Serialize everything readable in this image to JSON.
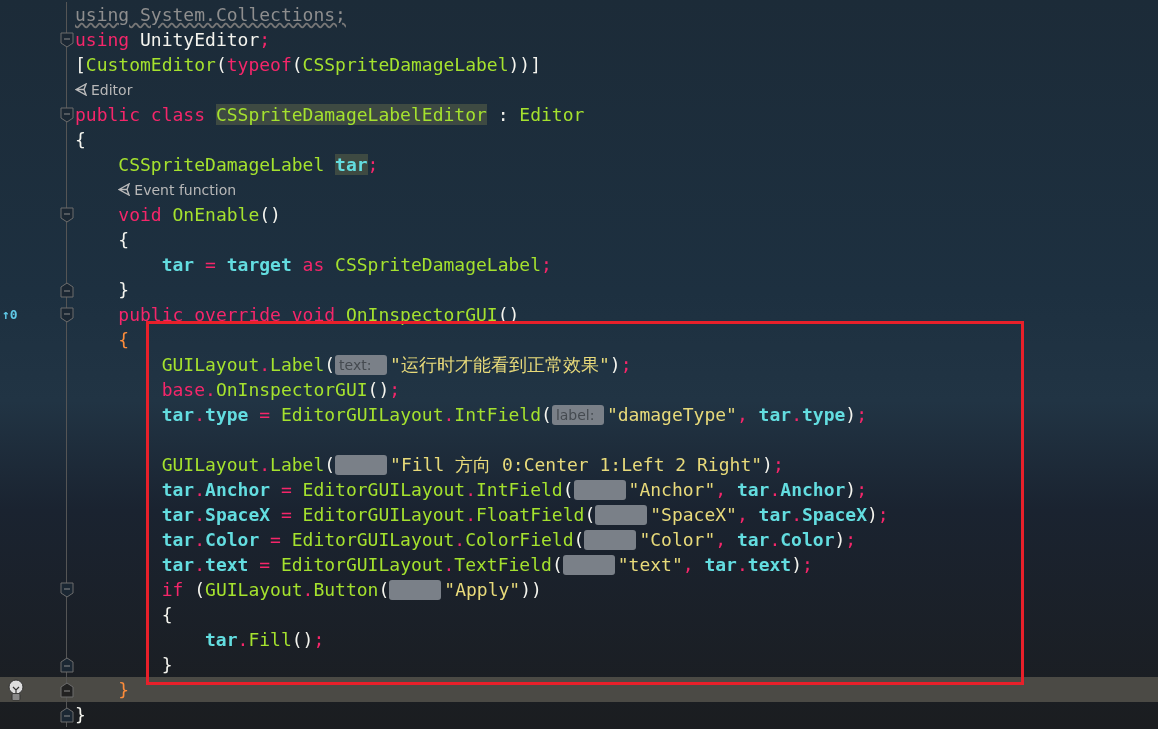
{
  "editor": {
    "lines": [
      {
        "kind": "code",
        "current": false,
        "fold_start": false,
        "fold_end": false,
        "tokens": [
          {
            "kind": "unused",
            "text": "using System.Collections;"
          }
        ]
      },
      {
        "kind": "code",
        "current": false,
        "fold_start": true,
        "fold_end": false,
        "tokens": [
          {
            "kind": "keyword",
            "text": "using"
          },
          {
            "kind": "plain",
            "text": " UnityEditor"
          },
          {
            "kind": "keyword",
            "text": ";"
          }
        ]
      },
      {
        "kind": "code",
        "current": false,
        "fold_start": false,
        "fold_end": false,
        "tokens": [
          {
            "kind": "plain",
            "text": "["
          },
          {
            "kind": "type",
            "text": "CustomEditor"
          },
          {
            "kind": "plain",
            "text": "("
          },
          {
            "kind": "keyword",
            "text": "typeof"
          },
          {
            "kind": "plain",
            "text": "("
          },
          {
            "kind": "type",
            "text": "CSSpriteDamageLabel"
          },
          {
            "kind": "plain",
            "text": "))]"
          }
        ]
      },
      {
        "kind": "codelens",
        "current": false,
        "fold_start": false,
        "fold_end": false,
        "text": "Editor"
      },
      {
        "kind": "code",
        "current": false,
        "fold_start": true,
        "fold_end": false,
        "tokens": [
          {
            "kind": "keyword",
            "text": "public class "
          },
          {
            "kind": "type",
            "text": "CSSpriteDamageLabelEditor",
            "mark": true
          },
          {
            "kind": "plain",
            "text": " : "
          },
          {
            "kind": "type",
            "text": "Editor"
          }
        ]
      },
      {
        "kind": "code",
        "current": false,
        "fold_start": false,
        "fold_end": false,
        "tokens": [
          {
            "kind": "plain",
            "text": "{"
          }
        ],
        "children": [
          {
            "kind": "code",
            "current": false,
            "fold_start": false,
            "fold_end": false,
            "tokens": [
              {
                "kind": "type",
                "text": "CSSpriteDamageLabel "
              },
              {
                "kind": "identifier",
                "text": "tar",
                "mark": true
              },
              {
                "kind": "keyword",
                "text": ";"
              }
            ]
          },
          {
            "kind": "codelens",
            "current": false,
            "fold_start": false,
            "fold_end": false,
            "text": "Event function"
          },
          {
            "kind": "code",
            "current": false,
            "fold_start": true,
            "fold_end": false,
            "tokens": [
              {
                "kind": "keyword",
                "text": "void "
              },
              {
                "kind": "type",
                "text": "OnEnable"
              },
              {
                "kind": "plain",
                "text": "()"
              }
            ]
          },
          {
            "kind": "code",
            "current": false,
            "fold_start": false,
            "fold_end": false,
            "tokens": [
              {
                "kind": "plain",
                "text": "{"
              }
            ],
            "children": [
              {
                "kind": "code",
                "current": false,
                "fold_start": false,
                "fold_end": false,
                "tokens": [
                  {
                    "kind": "identifier",
                    "text": "tar"
                  },
                  {
                    "kind": "keyword",
                    "text": " = "
                  },
                  {
                    "kind": "identifier",
                    "text": "target"
                  },
                  {
                    "kind": "keyword",
                    "text": " as "
                  },
                  {
                    "kind": "type",
                    "text": "CSSpriteDamageLabel"
                  },
                  {
                    "kind": "keyword",
                    "text": ";"
                  }
                ]
              }
            ]
          },
          {
            "kind": "code",
            "current": false,
            "fold_start": false,
            "fold_end": true,
            "tokens": [
              {
                "kind": "plain",
                "text": "}"
              }
            ]
          },
          {
            "kind": "code",
            "current": false,
            "fold_start": true,
            "fold_end": false,
            "badge": "↑0",
            "tokens": [
              {
                "kind": "keyword",
                "text": "public override void "
              },
              {
                "kind": "type",
                "text": "OnInspectorGUI"
              },
              {
                "kind": "plain",
                "text": "()"
              }
            ]
          },
          {
            "kind": "code",
            "current": false,
            "fold_start": false,
            "fold_end": false,
            "tokens": [
              {
                "kind": "brace",
                "text": "{"
              }
            ],
            "children": [
              {
                "kind": "code",
                "current": false,
                "fold_start": false,
                "fold_end": false,
                "tokens": [
                  {
                    "kind": "type",
                    "text": "GUILayout"
                  },
                  {
                    "kind": "keyword",
                    "text": "."
                  },
                  {
                    "kind": "type",
                    "text": "Label"
                  },
                  {
                    "kind": "plain",
                    "text": "("
                  },
                  {
                    "kind": "hint",
                    "text": "text:"
                  },
                  {
                    "kind": "string",
                    "text": "\"运行时才能看到正常效果\""
                  },
                  {
                    "kind": "plain",
                    "text": ")"
                  },
                  {
                    "kind": "keyword",
                    "text": ";"
                  }
                ]
              },
              {
                "kind": "code",
                "current": false,
                "fold_start": false,
                "fold_end": false,
                "tokens": [
                  {
                    "kind": "keyword",
                    "text": "base"
                  },
                  {
                    "kind": "keyword",
                    "text": "."
                  },
                  {
                    "kind": "type",
                    "text": "OnInspectorGUI"
                  },
                  {
                    "kind": "plain",
                    "text": "()"
                  },
                  {
                    "kind": "keyword",
                    "text": ";"
                  }
                ]
              },
              {
                "kind": "code",
                "current": false,
                "fold_start": false,
                "fold_end": false,
                "tokens": [
                  {
                    "kind": "identifier",
                    "text": "tar"
                  },
                  {
                    "kind": "keyword",
                    "text": "."
                  },
                  {
                    "kind": "identifier",
                    "text": "type"
                  },
                  {
                    "kind": "keyword",
                    "text": " = "
                  },
                  {
                    "kind": "type",
                    "text": "EditorGUILayout"
                  },
                  {
                    "kind": "keyword",
                    "text": "."
                  },
                  {
                    "kind": "type",
                    "text": "IntField"
                  },
                  {
                    "kind": "plain",
                    "text": "("
                  },
                  {
                    "kind": "hint",
                    "text": "label:"
                  },
                  {
                    "kind": "string",
                    "text": "\"damageType\""
                  },
                  {
                    "kind": "keyword",
                    "text": ", "
                  },
                  {
                    "kind": "identifier",
                    "text": "tar"
                  },
                  {
                    "kind": "keyword",
                    "text": "."
                  },
                  {
                    "kind": "identifier",
                    "text": "type"
                  },
                  {
                    "kind": "plain",
                    "text": ")"
                  },
                  {
                    "kind": "keyword",
                    "text": ";"
                  }
                ]
              },
              {
                "kind": "blank",
                "current": false,
                "fold_start": false,
                "fold_end": false
              },
              {
                "kind": "code",
                "current": false,
                "fold_start": false,
                "fold_end": false,
                "tokens": [
                  {
                    "kind": "type",
                    "text": "GUILayout"
                  },
                  {
                    "kind": "keyword",
                    "text": "."
                  },
                  {
                    "kind": "type",
                    "text": "Label"
                  },
                  {
                    "kind": "plain",
                    "text": "("
                  },
                  {
                    "kind": "hint"
                  },
                  {
                    "kind": "string",
                    "text": "\"Fill 方向 0:Center 1:Left 2 Right\""
                  },
                  {
                    "kind": "plain",
                    "text": ")"
                  },
                  {
                    "kind": "keyword",
                    "text": ";"
                  }
                ]
              },
              {
                "kind": "code",
                "current": false,
                "fold_start": false,
                "fold_end": false,
                "tokens": [
                  {
                    "kind": "identifier",
                    "text": "tar"
                  },
                  {
                    "kind": "keyword",
                    "text": "."
                  },
                  {
                    "kind": "identifier",
                    "text": "Anchor"
                  },
                  {
                    "kind": "keyword",
                    "text": " = "
                  },
                  {
                    "kind": "type",
                    "text": "EditorGUILayout"
                  },
                  {
                    "kind": "keyword",
                    "text": "."
                  },
                  {
                    "kind": "type",
                    "text": "IntField"
                  },
                  {
                    "kind": "plain",
                    "text": "("
                  },
                  {
                    "kind": "hint"
                  },
                  {
                    "kind": "string",
                    "text": "\"Anchor\""
                  },
                  {
                    "kind": "keyword",
                    "text": ", "
                  },
                  {
                    "kind": "identifier",
                    "text": "tar"
                  },
                  {
                    "kind": "keyword",
                    "text": "."
                  },
                  {
                    "kind": "identifier",
                    "text": "Anchor"
                  },
                  {
                    "kind": "plain",
                    "text": ")"
                  },
                  {
                    "kind": "keyword",
                    "text": ";"
                  }
                ]
              },
              {
                "kind": "code",
                "current": false,
                "fold_start": false,
                "fold_end": false,
                "tokens": [
                  {
                    "kind": "identifier",
                    "text": "tar"
                  },
                  {
                    "kind": "keyword",
                    "text": "."
                  },
                  {
                    "kind": "identifier",
                    "text": "SpaceX"
                  },
                  {
                    "kind": "keyword",
                    "text": " = "
                  },
                  {
                    "kind": "type",
                    "text": "EditorGUILayout"
                  },
                  {
                    "kind": "keyword",
                    "text": "."
                  },
                  {
                    "kind": "type",
                    "text": "FloatField"
                  },
                  {
                    "kind": "plain",
                    "text": "("
                  },
                  {
                    "kind": "hint"
                  },
                  {
                    "kind": "string",
                    "text": "\"SpaceX\""
                  },
                  {
                    "kind": "keyword",
                    "text": ", "
                  },
                  {
                    "kind": "identifier",
                    "text": "tar"
                  },
                  {
                    "kind": "keyword",
                    "text": "."
                  },
                  {
                    "kind": "identifier",
                    "text": "SpaceX"
                  },
                  {
                    "kind": "plain",
                    "text": ")"
                  },
                  {
                    "kind": "keyword",
                    "text": ";"
                  }
                ]
              },
              {
                "kind": "code",
                "current": false,
                "fold_start": false,
                "fold_end": false,
                "tokens": [
                  {
                    "kind": "identifier",
                    "text": "tar"
                  },
                  {
                    "kind": "keyword",
                    "text": "."
                  },
                  {
                    "kind": "identifier",
                    "text": "Color"
                  },
                  {
                    "kind": "keyword",
                    "text": " = "
                  },
                  {
                    "kind": "type",
                    "text": "EditorGUILayout"
                  },
                  {
                    "kind": "keyword",
                    "text": "."
                  },
                  {
                    "kind": "type",
                    "text": "ColorField"
                  },
                  {
                    "kind": "plain",
                    "text": "("
                  },
                  {
                    "kind": "hint"
                  },
                  {
                    "kind": "string",
                    "text": "\"Color\""
                  },
                  {
                    "kind": "keyword",
                    "text": ", "
                  },
                  {
                    "kind": "identifier",
                    "text": "tar"
                  },
                  {
                    "kind": "keyword",
                    "text": "."
                  },
                  {
                    "kind": "identifier",
                    "text": "Color"
                  },
                  {
                    "kind": "plain",
                    "text": ")"
                  },
                  {
                    "kind": "keyword",
                    "text": ";"
                  }
                ]
              },
              {
                "kind": "code",
                "current": false,
                "fold_start": false,
                "fold_end": false,
                "tokens": [
                  {
                    "kind": "identifier",
                    "text": "tar"
                  },
                  {
                    "kind": "keyword",
                    "text": "."
                  },
                  {
                    "kind": "identifier",
                    "text": "text"
                  },
                  {
                    "kind": "keyword",
                    "text": " = "
                  },
                  {
                    "kind": "type",
                    "text": "EditorGUILayout"
                  },
                  {
                    "kind": "keyword",
                    "text": "."
                  },
                  {
                    "kind": "type",
                    "text": "TextField"
                  },
                  {
                    "kind": "plain",
                    "text": "("
                  },
                  {
                    "kind": "hint"
                  },
                  {
                    "kind": "string",
                    "text": "\"text\""
                  },
                  {
                    "kind": "keyword",
                    "text": ", "
                  },
                  {
                    "kind": "identifier",
                    "text": "tar"
                  },
                  {
                    "kind": "keyword",
                    "text": "."
                  },
                  {
                    "kind": "identifier",
                    "text": "text"
                  },
                  {
                    "kind": "plain",
                    "text": ")"
                  },
                  {
                    "kind": "keyword",
                    "text": ";"
                  }
                ]
              },
              {
                "kind": "code",
                "current": false,
                "fold_start": true,
                "fold_end": false,
                "tokens": [
                  {
                    "kind": "keyword",
                    "text": "if "
                  },
                  {
                    "kind": "plain",
                    "text": "("
                  },
                  {
                    "kind": "type",
                    "text": "GUILayout"
                  },
                  {
                    "kind": "keyword",
                    "text": "."
                  },
                  {
                    "kind": "type",
                    "text": "Button"
                  },
                  {
                    "kind": "plain",
                    "text": "("
                  },
                  {
                    "kind": "hint"
                  },
                  {
                    "kind": "string",
                    "text": "\"Apply\""
                  },
                  {
                    "kind": "plain",
                    "text": "))"
                  }
                ]
              },
              {
                "kind": "code",
                "current": false,
                "fold_start": false,
                "fold_end": false,
                "tokens": [
                  {
                    "kind": "plain",
                    "text": "{"
                  }
                ],
                "children": [
                  {
                    "kind": "code",
                    "current": false,
                    "fold_start": false,
                    "fold_end": false,
                    "tokens": [
                      {
                        "kind": "identifier",
                        "text": "tar"
                      },
                      {
                        "kind": "keyword",
                        "text": "."
                      },
                      {
                        "kind": "type",
                        "text": "Fill"
                      },
                      {
                        "kind": "plain",
                        "text": "()"
                      },
                      {
                        "kind": "keyword",
                        "text": ";"
                      }
                    ]
                  }
                ]
              },
              {
                "kind": "code",
                "current": false,
                "fold_start": false,
                "fold_end": true,
                "tokens": [
                  {
                    "kind": "plain",
                    "text": "}"
                  }
                ]
              }
            ]
          },
          {
            "kind": "code",
            "current": true,
            "fold_start": false,
            "fold_end": true,
            "lightbulb": true,
            "tokens": [
              {
                "kind": "brace",
                "text": "}"
              }
            ]
          }
        ]
      },
      {
        "kind": "code",
        "current": false,
        "fold_start": false,
        "fold_end": true,
        "tokens": [
          {
            "kind": "plain",
            "text": "}"
          }
        ]
      }
    ]
  }
}
